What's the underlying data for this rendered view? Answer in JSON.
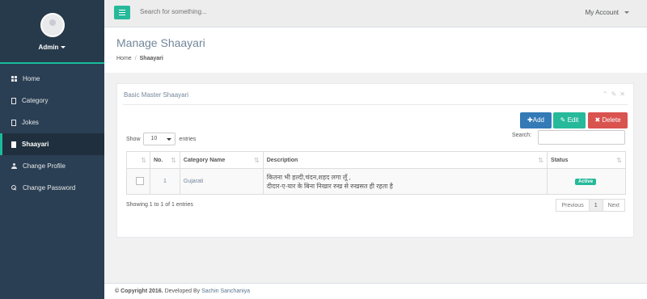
{
  "sidebar": {
    "profile_name": "Admin",
    "items": [
      {
        "label": "Home",
        "icon": "th-icon"
      },
      {
        "label": "Category",
        "icon": "file-icon"
      },
      {
        "label": "Jokes",
        "icon": "file-icon"
      },
      {
        "label": "Shaayari",
        "icon": "file-icon",
        "active": true
      },
      {
        "label": "Change Profile",
        "icon": "user-icon"
      },
      {
        "label": "Change Password",
        "icon": "key-icon"
      }
    ]
  },
  "topbar": {
    "search_placeholder": "Search for something...",
    "account_label": "My Account"
  },
  "page": {
    "title": "Manage Shaayari",
    "breadcrumb_home": "Home",
    "breadcrumb_current": "Shaayari"
  },
  "panel": {
    "title": "Basic Master Shaayari",
    "add_label": "Add",
    "edit_label": "Edit",
    "delete_label": "Delete",
    "show_label": "Show",
    "entries_value": "10",
    "entries_label": "entries",
    "search_label": "Search:"
  },
  "table": {
    "headers": [
      "No.",
      "Category Name",
      "Description",
      "Status"
    ],
    "rows": [
      {
        "no": "1",
        "category": "Gujarati",
        "description_line1": "कितना भी हल्दी,चंदन,शहद लगा लूँ ,",
        "description_line2": "दीदार-ए-यार के बिना निखार रुख से रुखसत ही रहता है",
        "status": "Active"
      }
    ],
    "info": "Showing 1 to 1 of 1 entries",
    "pager": {
      "previous": "Previous",
      "current": "1",
      "next": "Next"
    }
  },
  "footer": {
    "copyright": "© Copyright 2016.",
    "developed_by": "Developed By",
    "author": "Sachin Sanchaniya"
  },
  "colors": {
    "sidebar_bg": "#2a3f54",
    "accent_green": "#26b99a",
    "primary_blue": "#337ab7",
    "danger_red": "#d9534f"
  }
}
